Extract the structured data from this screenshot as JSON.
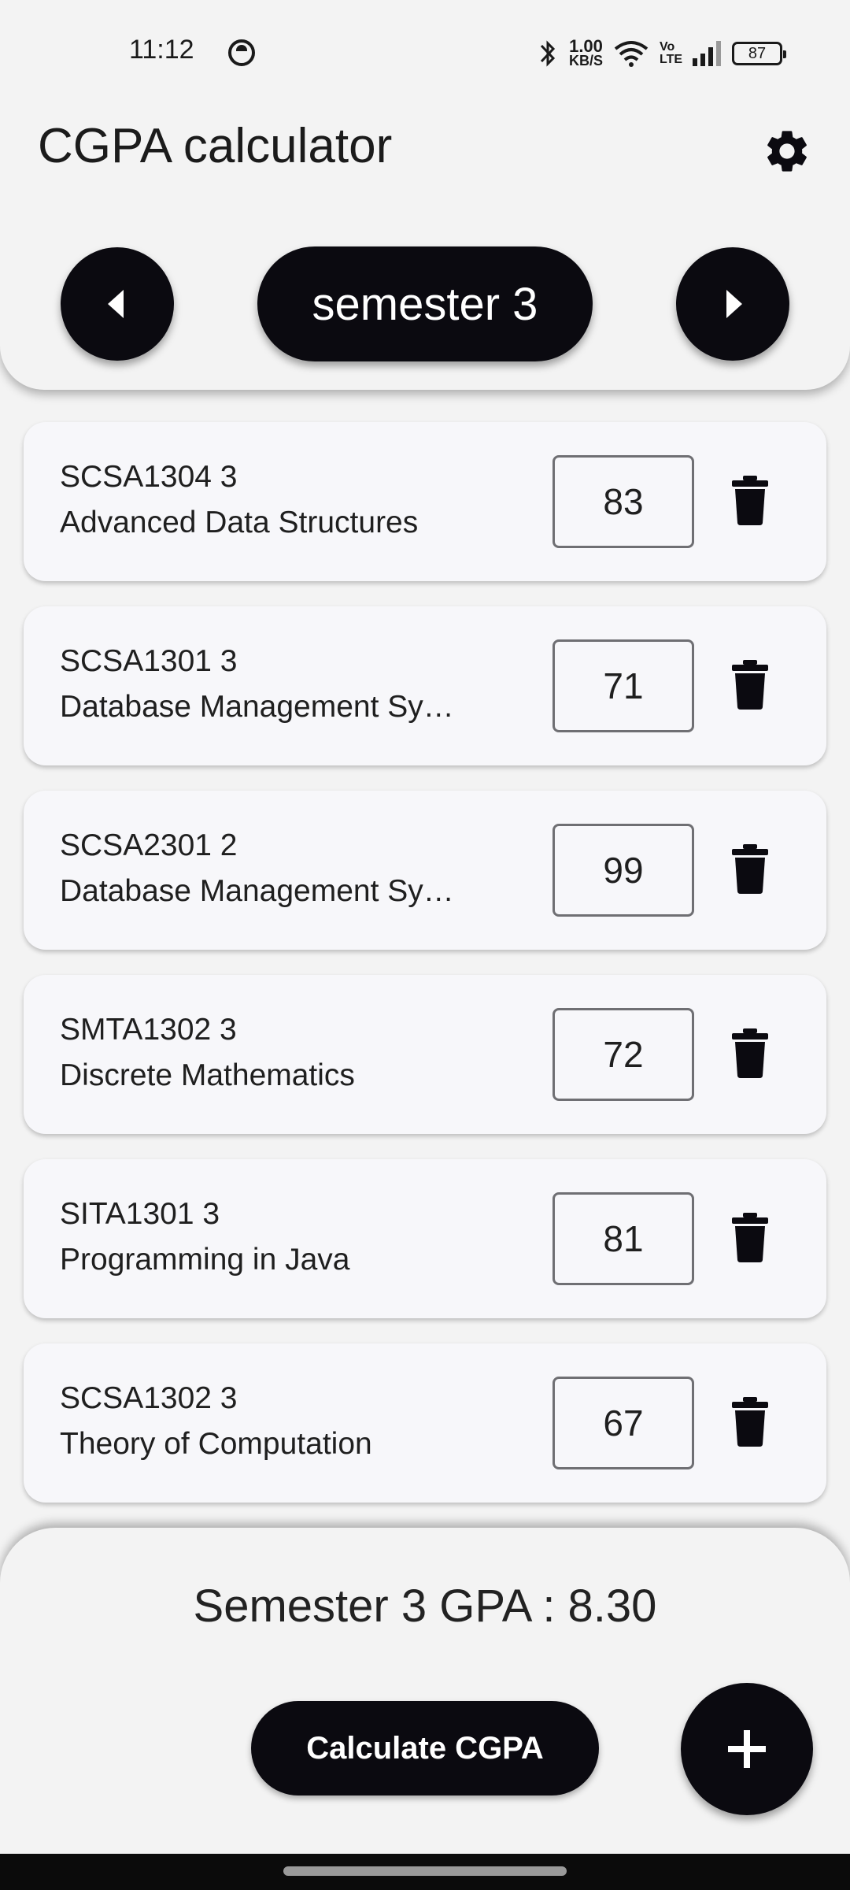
{
  "status_bar": {
    "time": "11:12",
    "net_speed_value": "1.00",
    "net_speed_unit": "KB/S",
    "volte": "Vo LTE",
    "battery": "87"
  },
  "header": {
    "title": "CGPA calculator",
    "semester_label": "semester 3",
    "settings_icon": "gear-icon",
    "prev_icon": "caret-left-icon",
    "next_icon": "caret-right-icon"
  },
  "courses": [
    {
      "code": "SCSA1304 3",
      "name": "Advanced Data Structures",
      "marks": "83"
    },
    {
      "code": "SCSA1301 3",
      "name": "Database Management Sy…",
      "marks": "71"
    },
    {
      "code": "SCSA2301 2",
      "name": "Database Management Sy…",
      "marks": "99"
    },
    {
      "code": "SMTA1302 3",
      "name": "Discrete Mathematics",
      "marks": "72"
    },
    {
      "code": "SITA1301 3",
      "name": "Programming in Java",
      "marks": "81"
    },
    {
      "code": "SCSA1302 3",
      "name": "Theory of Computation",
      "marks": "67"
    }
  ],
  "footer": {
    "gpa_text": "Semester 3 GPA : 8.30",
    "calculate_label": "Calculate CGPA",
    "add_icon": "plus-icon"
  },
  "colors": {
    "accent": "#0b0a10",
    "background": "#f3f3f3",
    "card": "#f7f7fa"
  }
}
